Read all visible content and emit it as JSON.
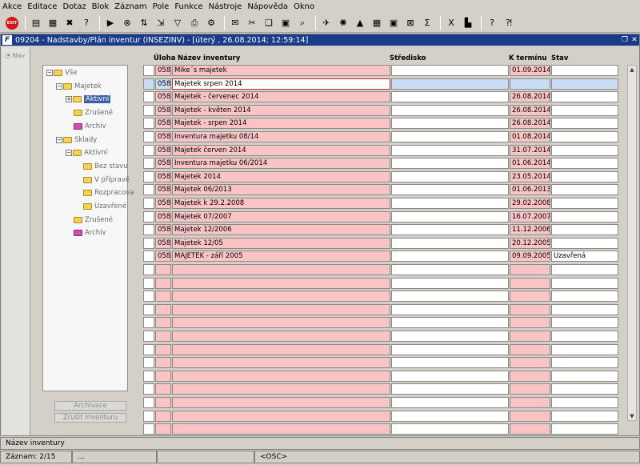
{
  "menu": [
    "Akce",
    "Editace",
    "Dotaz",
    "Blok",
    "Záznam",
    "Pole",
    "Funkce",
    "Nástroje",
    "Nápověda",
    "Okno"
  ],
  "toolbar": {
    "exit_label": "EXIT",
    "icons": [
      "new-record-icon",
      "save-icon",
      "delete-icon",
      "enter-query-icon",
      "execute-query-icon",
      "cancel-query-icon",
      "sort-icon",
      "export-icon",
      "filter-icon",
      "print-icon",
      "tools-icon",
      "mail-icon",
      "cut-icon",
      "copy-icon",
      "paste-icon",
      "find-icon",
      "run-icon",
      "wheel-icon",
      "triangle-icon",
      "calendar-icon",
      "image-icon",
      "exit-form-icon",
      "sum-icon",
      "excel-icon",
      "chart-icon",
      "help-icon",
      "context-help-icon"
    ]
  },
  "window": {
    "title": "09204 - Nadstavby/Plán inventur (INSEZINV) - [úterý , 26.08.2014; 12:59:14]",
    "logo": "F"
  },
  "nav": {
    "label": "Nav"
  },
  "tree": [
    {
      "label": "Vše",
      "level": 0,
      "expander": "−",
      "selected": false,
      "pink": false
    },
    {
      "label": "Majetek",
      "level": 1,
      "expander": "−",
      "selected": false,
      "pink": false
    },
    {
      "label": "Aktivní",
      "level": 2,
      "expander": "+",
      "selected": true,
      "pink": false
    },
    {
      "label": "Zrušené",
      "level": 2,
      "expander": "",
      "selected": false,
      "pink": false
    },
    {
      "label": "Archiv",
      "level": 2,
      "expander": "",
      "selected": false,
      "pink": true
    },
    {
      "label": "Sklady",
      "level": 1,
      "expander": "−",
      "selected": false,
      "pink": false
    },
    {
      "label": "Aktivní",
      "level": 2,
      "expander": "−",
      "selected": false,
      "pink": false
    },
    {
      "label": "Bez stavu",
      "level": 3,
      "expander": "",
      "selected": false,
      "pink": false
    },
    {
      "label": "V přípravě",
      "level": 3,
      "expander": "",
      "selected": false,
      "pink": false
    },
    {
      "label": "Rozpracova",
      "level": 3,
      "expander": "",
      "selected": false,
      "pink": false
    },
    {
      "label": "Uzavřené",
      "level": 3,
      "expander": "",
      "selected": false,
      "pink": false
    },
    {
      "label": "Zrušené",
      "level": 2,
      "expander": "",
      "selected": false,
      "pink": false
    },
    {
      "label": "Archiv",
      "level": 2,
      "expander": "",
      "selected": false,
      "pink": true
    }
  ],
  "buttons": {
    "archivace": "Archivace",
    "zrusit": "Zrušit inventuru"
  },
  "columns": {
    "uloha": "Úloha",
    "nazev": "Název inventury",
    "stredisko": "Středisko",
    "termin": "K termínu",
    "stav": "Stav"
  },
  "rows": [
    {
      "code": "058",
      "name": "Mike´s majetek",
      "stredisko": "",
      "date": "01.09.2014",
      "stav": ""
    },
    {
      "code": "058",
      "name": "Majetek srpen 2014",
      "stredisko": "",
      "date": "",
      "stav": ""
    },
    {
      "code": "058",
      "name": "Majetek - červenec 2014",
      "stredisko": "",
      "date": "26.08.2014",
      "stav": ""
    },
    {
      "code": "058",
      "name": "Majetek - květen 2014",
      "stredisko": "",
      "date": "26.08.2014",
      "stav": ""
    },
    {
      "code": "058",
      "name": "Majetek - srpen 2014",
      "stredisko": "",
      "date": "26.08.2014",
      "stav": ""
    },
    {
      "code": "058",
      "name": "Inventura majetku 08/14",
      "stredisko": "",
      "date": "01.08.2014",
      "stav": ""
    },
    {
      "code": "058",
      "name": "Majetek červen 2014",
      "stredisko": "",
      "date": "31.07.2014",
      "stav": ""
    },
    {
      "code": "058",
      "name": "Inventura majetku 06/2014",
      "stredisko": "",
      "date": "01.06.2014",
      "stav": ""
    },
    {
      "code": "058",
      "name": "Majetek 2014",
      "stredisko": "",
      "date": "23.05.2014",
      "stav": ""
    },
    {
      "code": "058",
      "name": "Majetek 06/2013",
      "stredisko": "",
      "date": "01.06.2013",
      "stav": ""
    },
    {
      "code": "058",
      "name": "Majetek k 29.2.2008",
      "stredisko": "",
      "date": "29.02.2008",
      "stav": ""
    },
    {
      "code": "058",
      "name": "Majetek 07/2007",
      "stredisko": "",
      "date": "16.07.2007",
      "stav": ""
    },
    {
      "code": "058",
      "name": "Majetek 12/2006",
      "stredisko": "",
      "date": "11.12.2006",
      "stav": ""
    },
    {
      "code": "058",
      "name": "Majetek 12/05",
      "stredisko": "",
      "date": "20.12.2005",
      "stav": ""
    },
    {
      "code": "058",
      "name": "MAJETEK - září 2005",
      "stredisko": "",
      "date": "09.09.2005",
      "stav": "Uzavřená"
    }
  ],
  "current_row": 2,
  "total_rows": 29,
  "hint": "Název inventury",
  "status": {
    "record": "Záznam: 2/15",
    "seg2": "...",
    "seg3": "",
    "seg4": "<OSC>"
  }
}
